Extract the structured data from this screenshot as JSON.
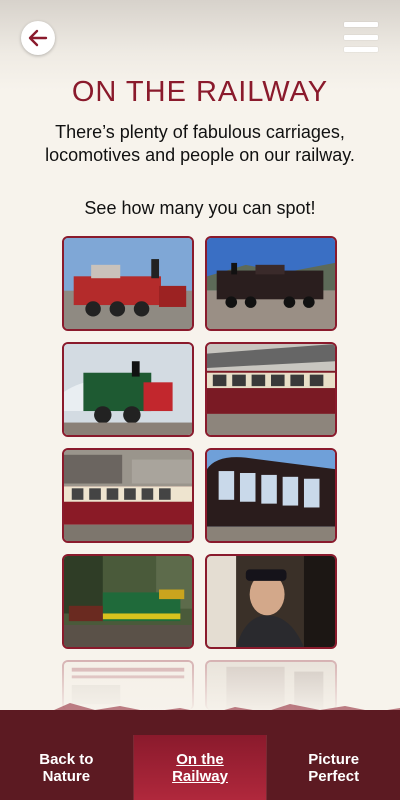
{
  "header": {
    "back_icon": "arrow-left-icon",
    "menu_icon": "hamburger-menu-icon"
  },
  "page": {
    "title": "ON THE RAILWAY",
    "intro": "There’s plenty of fabulous carriages, locomotives and people on our railway.",
    "prompt": "See how many you can spot!"
  },
  "gallery": {
    "partial_caption": "RHEILFFYRDD FFESTINIOG AC ERYRI / FFESTINIOG & WELSH HIGHLAND RAILWAYS"
  },
  "nav": {
    "items": [
      {
        "label_1": "Back to",
        "label_2": "Nature"
      },
      {
        "label_1": "On the",
        "label_2": "Railway"
      },
      {
        "label_1": "Picture",
        "label_2": "Perfect"
      }
    ]
  },
  "colors": {
    "accent": "#8a1a2c",
    "nav_bg": "#5c1a22",
    "background": "#f7f3ec"
  }
}
